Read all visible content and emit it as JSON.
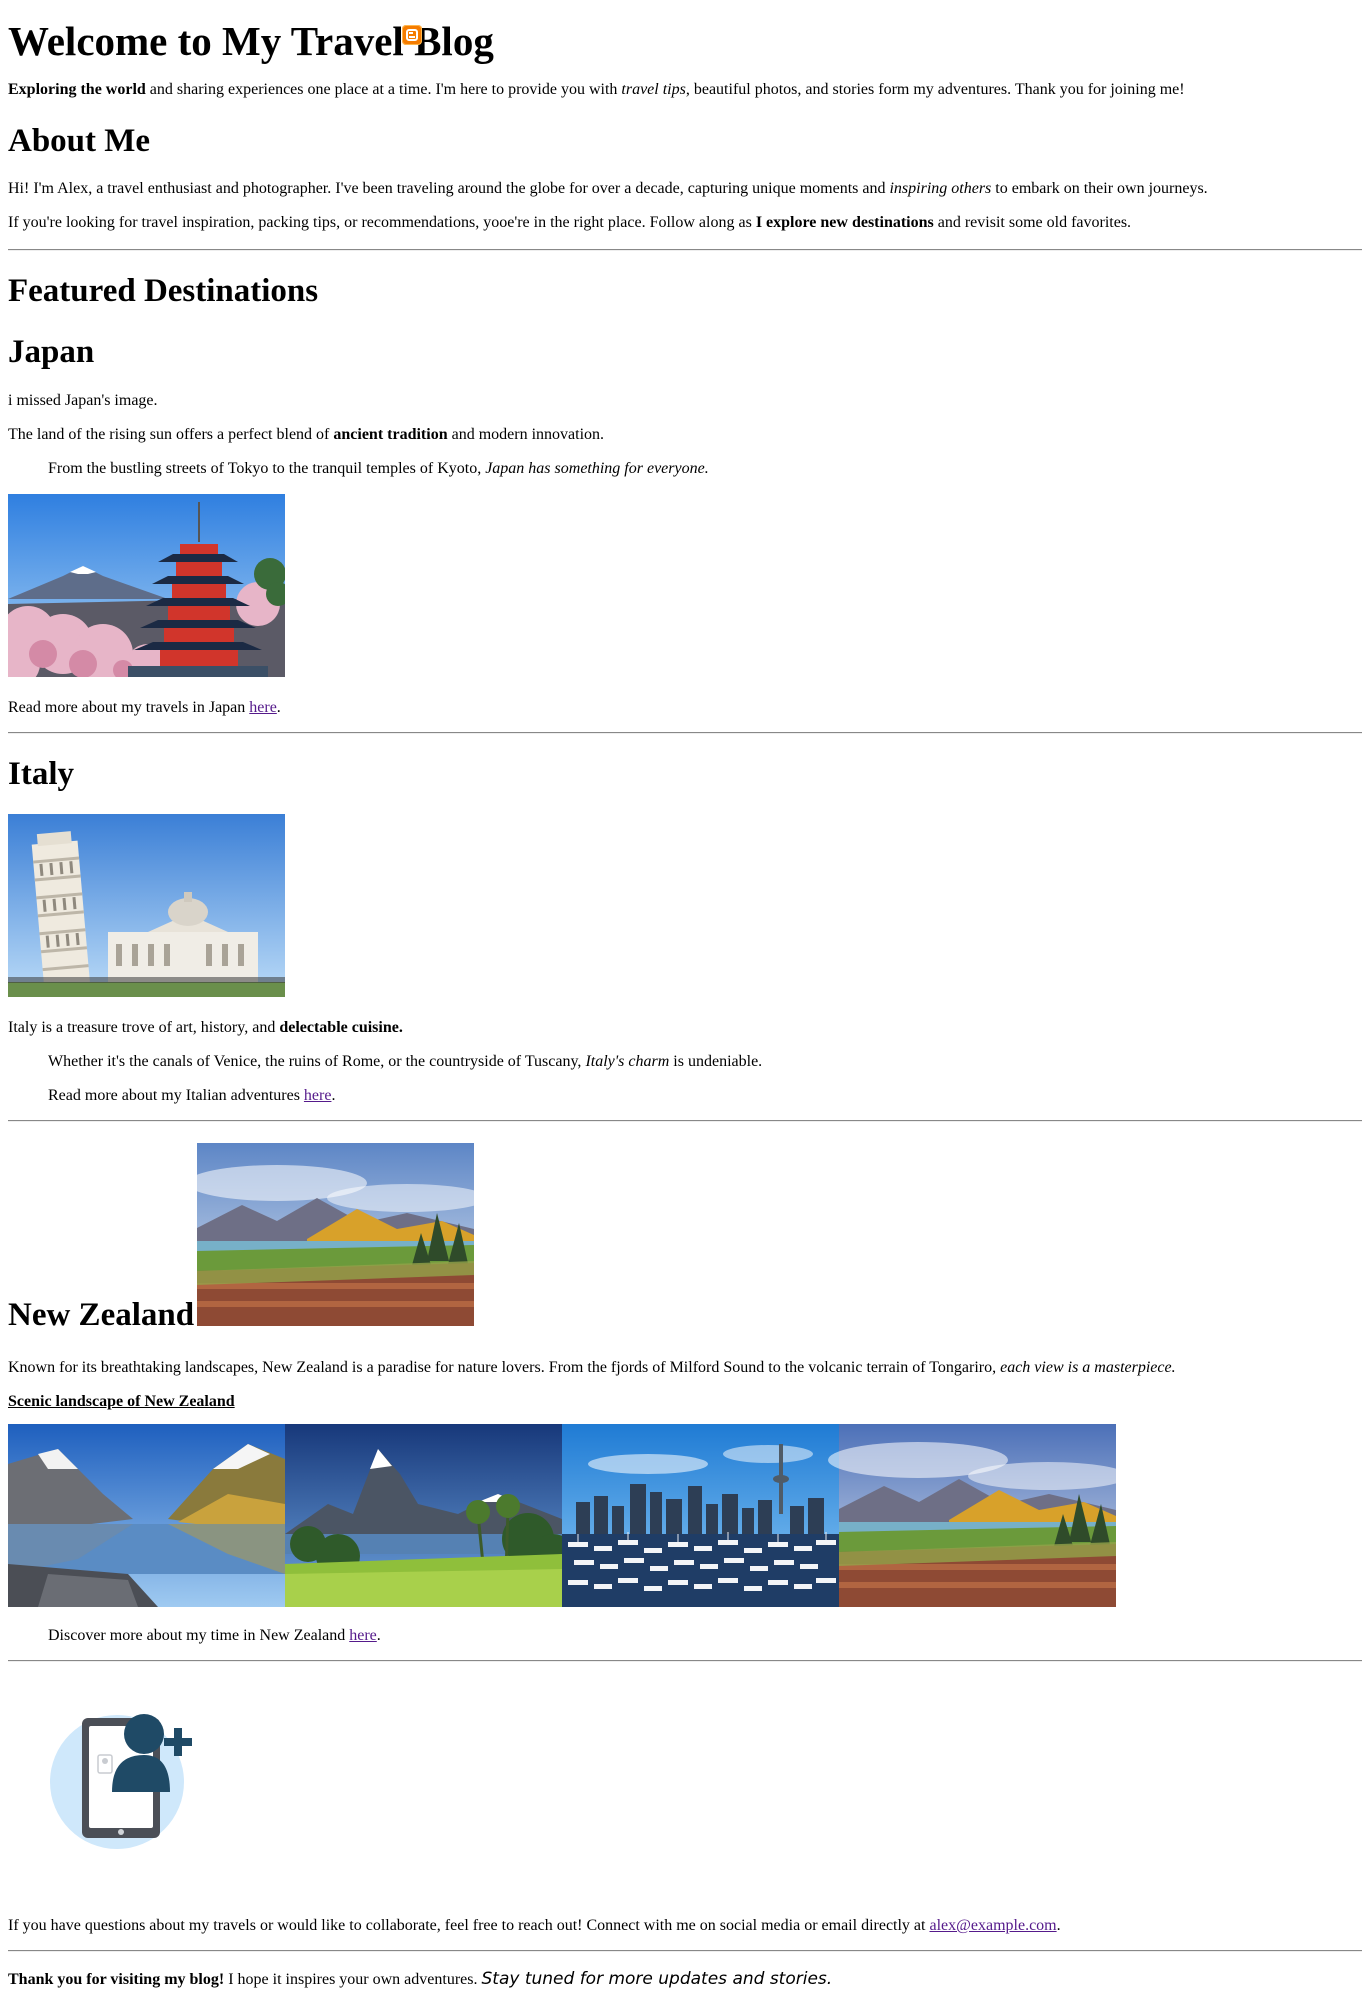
{
  "header": {
    "title": "Welcome to My Travel Blog",
    "intro": {
      "bold": "Exploring the world",
      "t1": " and sharing experiences one place at a time. I'm here to provide you with ",
      "italic": "travel tips",
      "t2": ", beautiful photos, and stories form my adventures. Thank you for joining me!"
    },
    "icon": "blogger-icon"
  },
  "about": {
    "heading": "About Me",
    "p1": {
      "t1": "Hi! I'm Alex, a travel enthusiast and photographer. I've been traveling around the globe for over a decade, capturing unique moments and ",
      "italic": "inspiring others",
      "t2": " to embark on their own journeys."
    },
    "p2": {
      "t1": "If you're looking for travel inspiration, packing tips, or recommendations, yooe're in the right place. Follow along as ",
      "bold": "I explore new destinations",
      "t2": " and revisit some old favorites."
    }
  },
  "featured": {
    "heading": "Featured Destinations"
  },
  "japan": {
    "heading": "Japan",
    "missing_image_text": "i missed Japan's image.",
    "p1": {
      "t1": "The land of the rising sun offers a perfect blend of ",
      "bold": "ancient tradition",
      "t2": " and modern innovation."
    },
    "p2": {
      "t1": "From the bustling streets of Tokyo to the tranquil temples of Kyoto, ",
      "italic": "Japan has something for everyone."
    },
    "read_more": {
      "t1": "Read more about my travels in Japan ",
      "link": "here",
      "t2": "."
    }
  },
  "italy": {
    "heading": "Italy",
    "p1": {
      "t1": "Italy is a treasure trove of art, history, and ",
      "bold": "delectable cuisine."
    },
    "p2": {
      "t1": "Whether it's the canals of Venice, the ruins of Rome, or the countryside of Tuscany, ",
      "italic": "Italy's charm",
      "t2": " is undeniable."
    },
    "read_more": {
      "t1": "Read more about my Italian adventures ",
      "link": "here",
      "t2": "."
    }
  },
  "nz": {
    "heading": "New Zealand",
    "p1": {
      "t1": "Known for its breathtaking landscapes, New Zealand is a paradise for nature lovers. From the fjords of Milford Sound to the volcanic terrain of Tongariro, ",
      "italic": "each view is a masterpiece."
    },
    "gallery_caption": "Scenic landscape of New Zealand",
    "discover": {
      "t1": "Discover more about my time in New Zealand ",
      "link": "here",
      "t2": "."
    }
  },
  "contact": {
    "icon": "add-contact-icon",
    "t1": "If you have questions about my travels or would like to collaborate, feel free to reach out! Connect with me on social media or email directly at ",
    "email": "alex@example.com",
    "t2": "."
  },
  "footer": {
    "bold": "Thank you for visiting my blog!",
    "t1": " I hope it inspires your own adventures. ",
    "italic": "Stay tuned for more updates and stories."
  },
  "colors": {
    "link": "#551a8b",
    "blogger_orange": "#f57c00",
    "contact_circle": "#cfe8fb",
    "contact_dark": "#1f4a66"
  }
}
